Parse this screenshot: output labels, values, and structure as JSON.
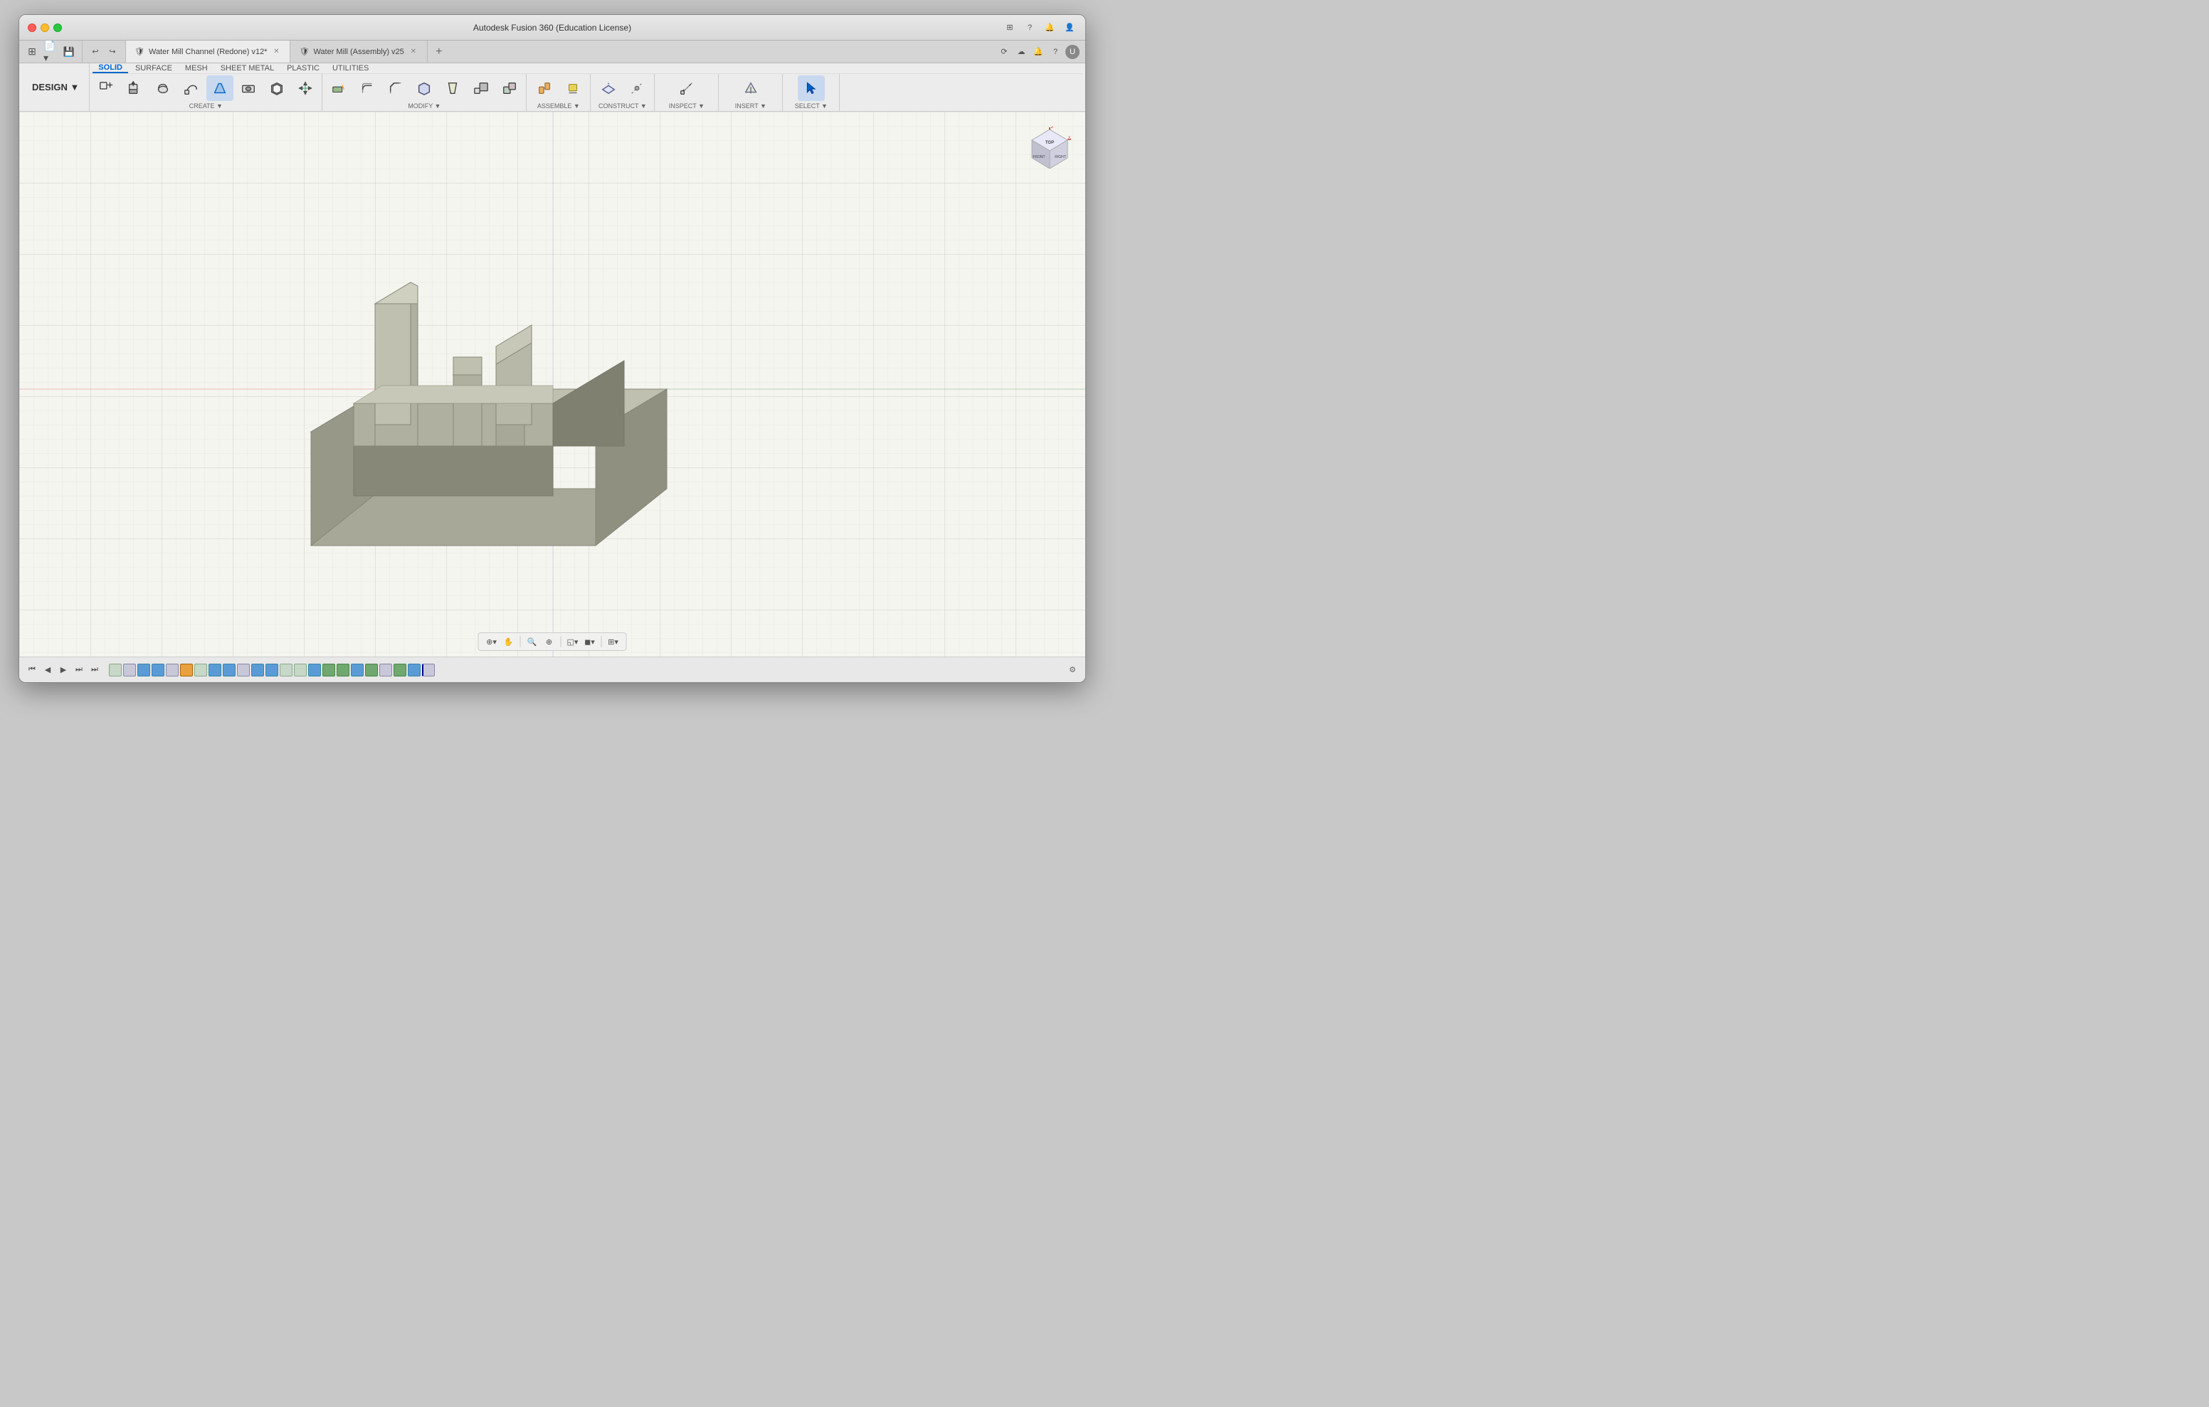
{
  "window": {
    "title": "Autodesk Fusion 360 (Education License)"
  },
  "tabs": [
    {
      "id": "tab1",
      "label": "Water Mill Channel (Redone) v12*",
      "icon": "🛡",
      "active": true
    },
    {
      "id": "tab2",
      "label": "Water Mill (Assembly) v25",
      "icon": "🛡",
      "active": false
    }
  ],
  "toolbar": {
    "design_label": "DESIGN ▼",
    "tabs": [
      "SOLID",
      "SURFACE",
      "MESH",
      "SHEET METAL",
      "PLASTIC",
      "UTILITIES"
    ],
    "active_tab": "SOLID",
    "groups": [
      {
        "name": "CREATE",
        "label": "CREATE ▼",
        "has_arrow": true
      },
      {
        "name": "MODIFY",
        "label": "MODIFY ▼",
        "has_arrow": true
      },
      {
        "name": "ASSEMBLE",
        "label": "ASSEMBLE ▼",
        "has_arrow": true
      },
      {
        "name": "CONSTRUCT",
        "label": "CONSTRUCT ▼",
        "has_arrow": true
      },
      {
        "name": "INSPECT",
        "label": "INSPECT ▼",
        "has_arrow": true
      },
      {
        "name": "INSERT",
        "label": "INSERT ▼",
        "has_arrow": true
      },
      {
        "name": "SELECT",
        "label": "SELECT ▼",
        "has_arrow": true,
        "active": true
      }
    ]
  },
  "viewport": {
    "model_color": "#9e9e8a",
    "grid_color": "#e0e0d8",
    "background": "#f0f0eb"
  },
  "bottom_toolbar": {
    "buttons": [
      "⊕▾",
      "✋",
      "🔍",
      "⊕",
      "◱▾",
      "◼▾",
      "⊞▾"
    ]
  },
  "timeline": {
    "nav_buttons": [
      "⏮",
      "◀",
      "▶",
      "⏭",
      "⏭"
    ]
  },
  "orientation_cube": {
    "faces": [
      "FRONT",
      "RIGHT",
      "TOP"
    ]
  }
}
